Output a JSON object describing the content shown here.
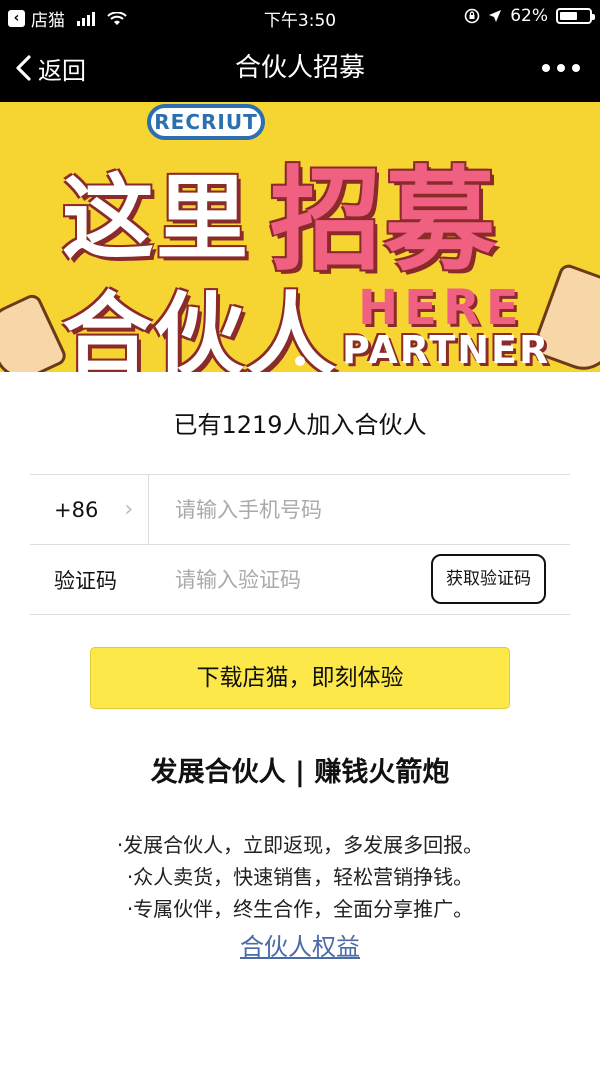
{
  "status": {
    "carrier": "店猫",
    "time": "下午3:50",
    "battery": "62%",
    "battery_level": 0.62
  },
  "nav": {
    "back_label": "返回",
    "title": "合伙人招募"
  },
  "banner": {
    "badge": "RECRIUT",
    "line1_a": "这里",
    "line1_b": "招募",
    "line2": "合伙人",
    "here": "HERE",
    "partner": "PARTNER"
  },
  "count_text": "已有1219人加入合伙人",
  "form": {
    "country_code": "+86",
    "phone_placeholder": "请输入手机号码",
    "code_label": "验证码",
    "code_placeholder": "请输入验证码",
    "get_code_label": "获取验证码"
  },
  "download_button": "下载店猫，即刻体验",
  "headline": "发展合伙人 | 赚钱火箭炮",
  "bullets": [
    "·发展合伙人，立即返现，多发展多回报。",
    "·众人卖货，快速销售，轻松营销挣钱。",
    "·专属伙伴，终生合作，全面分享推广。"
  ],
  "rights_link": "合伙人权益"
}
